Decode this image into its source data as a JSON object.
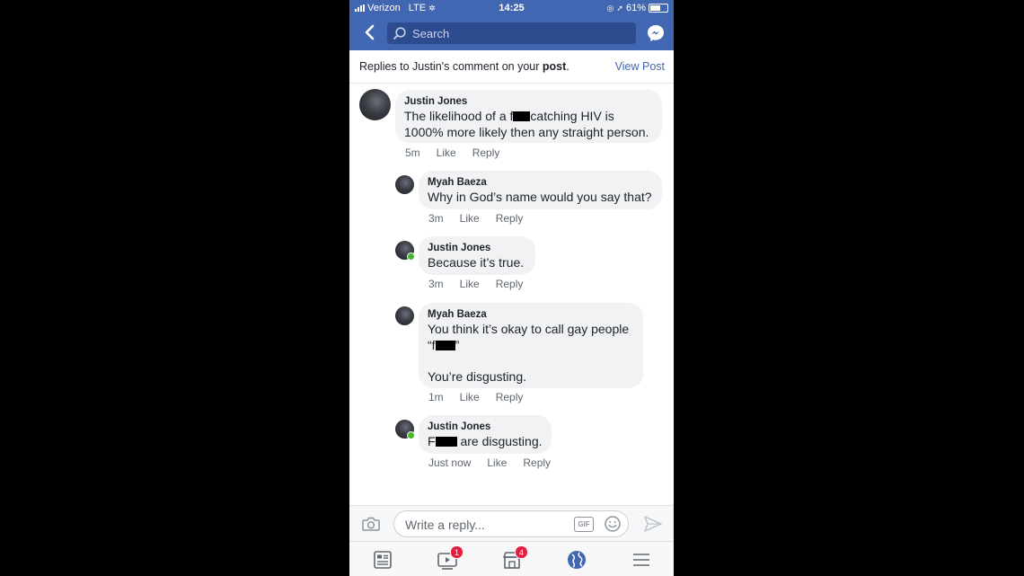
{
  "status_bar": {
    "carrier": "Verizon",
    "network": "LTE",
    "time": "14:25",
    "battery": "61%"
  },
  "header": {
    "search_placeholder": "Search",
    "back_icon": "chevron-left-icon",
    "messenger_icon": "messenger-icon"
  },
  "subheader": {
    "prefix": "Replies to Justin's comment on your ",
    "post_word": "post",
    "suffix": ".",
    "view_post": "View Post"
  },
  "comments": [
    {
      "name": "Justin Jones",
      "text_a": "The likelihood of a f",
      "text_b": "catching HIV is\n1000% more likely then any straight person.",
      "time": "5m",
      "like": "Like",
      "reply": "Reply"
    },
    {
      "name": "Myah Baeza",
      "text": "Why in God’s name would you say that?",
      "time": "3m",
      "like": "Like",
      "reply": "Reply"
    },
    {
      "name": "Justin Jones",
      "text": "Because it’s true.",
      "time": "3m",
      "like": "Like",
      "reply": "Reply"
    },
    {
      "name": "Myah Baeza",
      "text_a": "You think it’s okay to call gay people\n“f",
      "text_b": "”\n\nYou’re disgusting.",
      "time": "1m",
      "like": "Like",
      "reply": "Reply"
    },
    {
      "name": "Justin Jones",
      "text_a": "F",
      "text_b": " are disgusting.",
      "time": "Just now",
      "like": "Like",
      "reply": "Reply"
    }
  ],
  "composer": {
    "placeholder": "Write a reply...",
    "gif_label": "GIF"
  },
  "bottom_nav": {
    "video_badge": "1",
    "marketplace_badge": "4"
  },
  "colors": {
    "brand": "#4267b2",
    "bubble": "#f1f2f4",
    "badge": "#e41e3f",
    "online": "#42b72a"
  }
}
